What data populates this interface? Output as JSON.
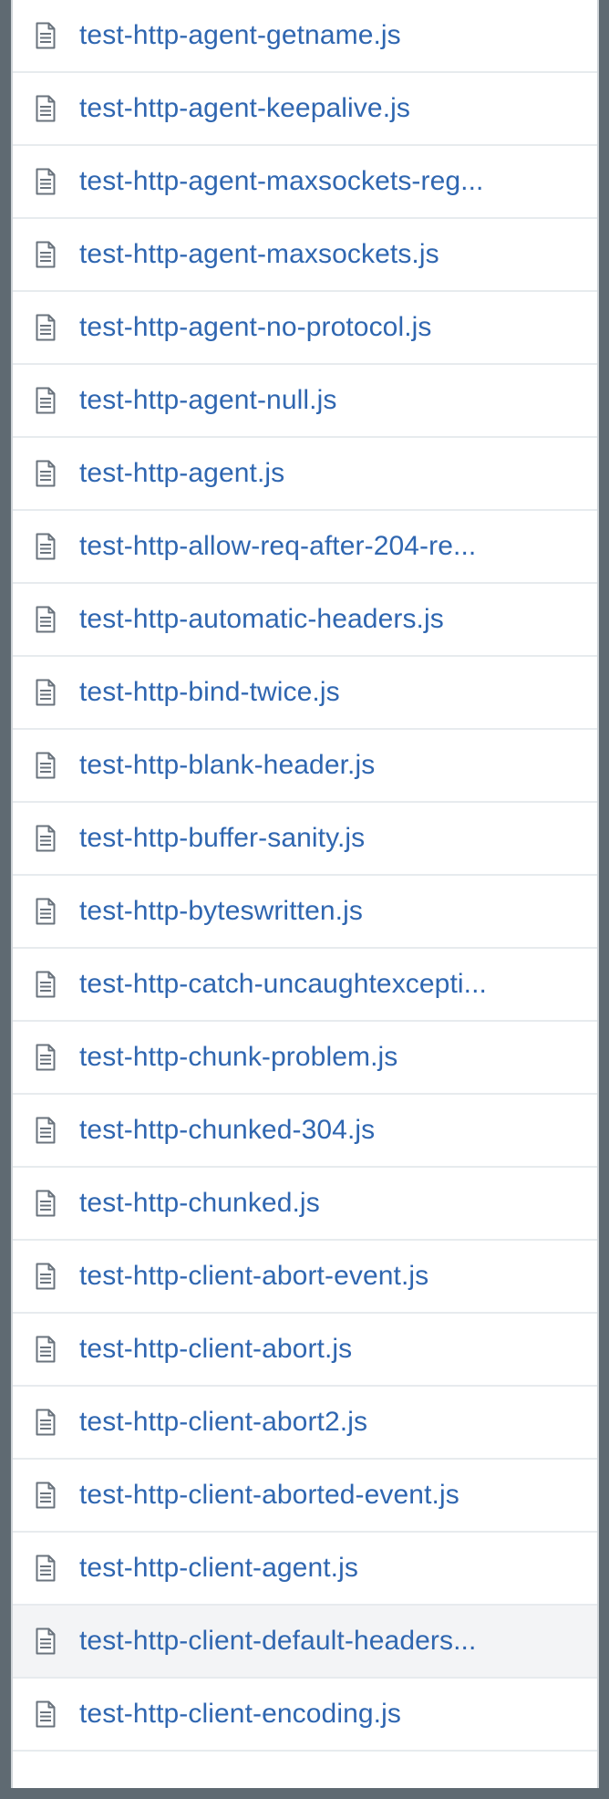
{
  "files": [
    {
      "name": "test-http-agent-getname.js",
      "icon": "file-icon"
    },
    {
      "name": "test-http-agent-keepalive.js",
      "icon": "file-icon"
    },
    {
      "name": "test-http-agent-maxsockets-reg...",
      "icon": "file-icon"
    },
    {
      "name": "test-http-agent-maxsockets.js",
      "icon": "file-icon"
    },
    {
      "name": "test-http-agent-no-protocol.js",
      "icon": "file-icon"
    },
    {
      "name": "test-http-agent-null.js",
      "icon": "file-icon"
    },
    {
      "name": "test-http-agent.js",
      "icon": "file-icon"
    },
    {
      "name": "test-http-allow-req-after-204-re...",
      "icon": "file-icon"
    },
    {
      "name": "test-http-automatic-headers.js",
      "icon": "file-icon"
    },
    {
      "name": "test-http-bind-twice.js",
      "icon": "file-icon"
    },
    {
      "name": "test-http-blank-header.js",
      "icon": "file-icon"
    },
    {
      "name": "test-http-buffer-sanity.js",
      "icon": "file-icon"
    },
    {
      "name": "test-http-byteswritten.js",
      "icon": "file-icon"
    },
    {
      "name": "test-http-catch-uncaughtexcepti...",
      "icon": "file-icon"
    },
    {
      "name": "test-http-chunk-problem.js",
      "icon": "file-icon"
    },
    {
      "name": "test-http-chunked-304.js",
      "icon": "file-icon"
    },
    {
      "name": "test-http-chunked.js",
      "icon": "file-icon"
    },
    {
      "name": "test-http-client-abort-event.js",
      "icon": "file-icon"
    },
    {
      "name": "test-http-client-abort.js",
      "icon": "file-icon"
    },
    {
      "name": "test-http-client-abort2.js",
      "icon": "file-icon"
    },
    {
      "name": "test-http-client-aborted-event.js",
      "icon": "file-icon"
    },
    {
      "name": "test-http-client-agent.js",
      "icon": "file-icon"
    },
    {
      "name": "test-http-client-default-headers...",
      "icon": "file-icon",
      "hovered": true
    },
    {
      "name": "test-http-client-encoding.js",
      "icon": "file-icon"
    }
  ],
  "colors": {
    "link": "#2f66b0",
    "icon": "#6a737d",
    "row_border": "#e7ebee",
    "hover_background": "#f3f4f6",
    "frame_background": "#5f6a72"
  }
}
